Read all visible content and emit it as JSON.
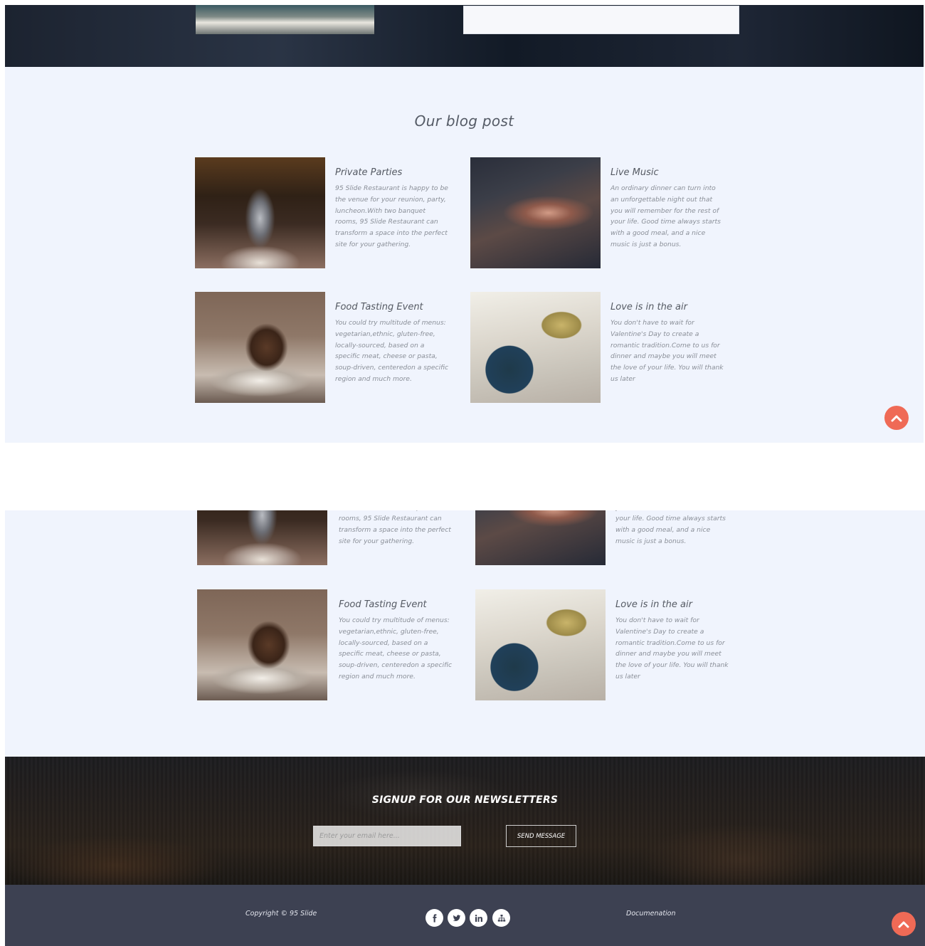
{
  "blog": {
    "title": "Our blog post",
    "posts": [
      {
        "title": "Private Parties",
        "text": "95 Slide Restaurant is happy to be the venue for your reunion, party, luncheon.With two banquet rooms, 95 Slide Restaurant can transform a space into the perfect site for your gathering."
      },
      {
        "title": "Live Music",
        "text": "An ordinary dinner can turn into an unforgettable night out that you will remember for the rest of your life. Good time always starts with a good meal, and a nice music is just a bonus."
      },
      {
        "title": "Food Tasting Event",
        "text": "You could try multitude of menus: vegetarian,ethnic, gluten-free, locally-sourced, based on a specific meat, cheese or pasta, soup-driven, centeredon a specific region and much more."
      },
      {
        "title": "Love is in the air",
        "text": "You don't have to wait for Valentine's Day to create a romantic tradition.Come to us for dinner and maybe you will meet the love of your life. You will thank us later"
      }
    ]
  },
  "newsletter": {
    "title": "SIGNUP FOR OUR NEWSLETTERS",
    "email_placeholder": "Enter your email here...",
    "email_value": "",
    "button_label": "SEND MESSAGE"
  },
  "footer": {
    "copyright": "Copyright © 95 Slide",
    "documentation": "Documenation",
    "social_icons": [
      "facebook-icon",
      "twitter-icon",
      "linkedin-icon",
      "sitemap-icon"
    ]
  },
  "colors": {
    "accent": "#ef6a56",
    "section_bg": "#f0f4fd",
    "footer_bg": "#3d4152"
  }
}
